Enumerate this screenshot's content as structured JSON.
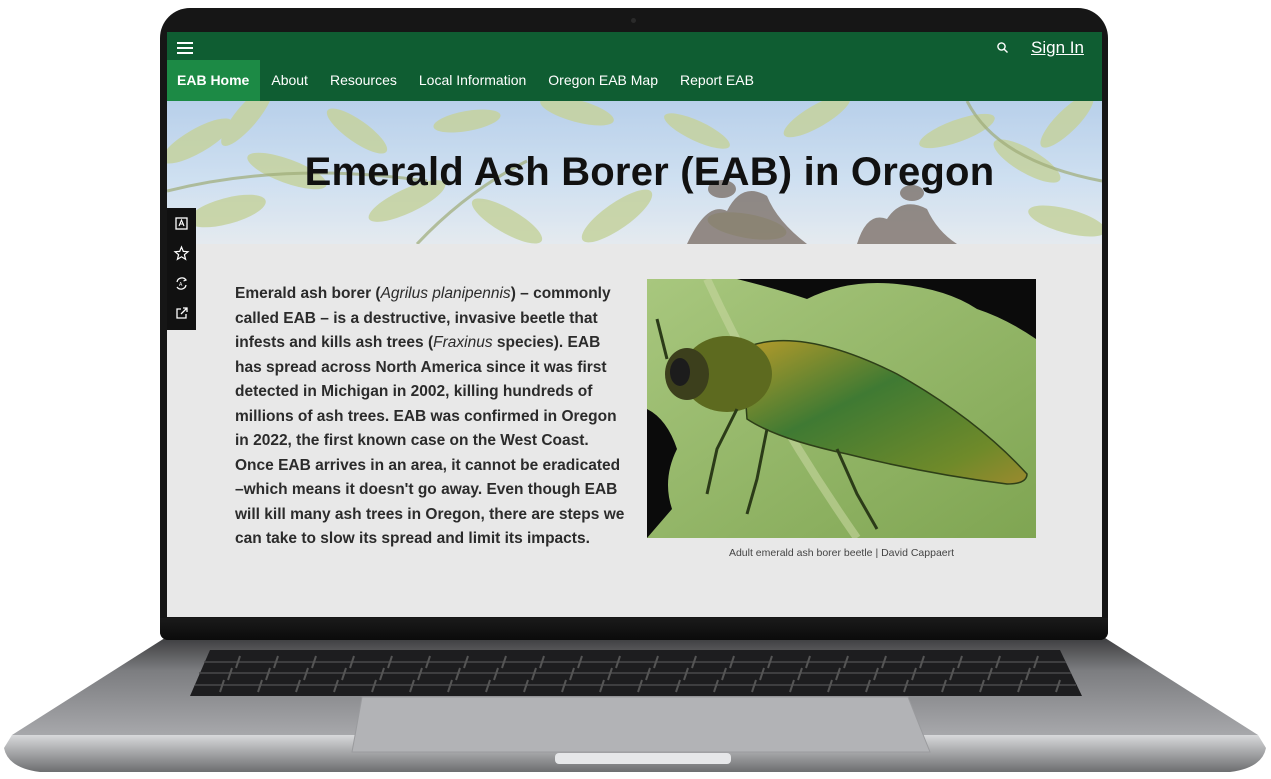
{
  "header": {
    "menu_icon": "hamburger-menu-icon",
    "search_icon": "search-icon",
    "signin_label": "Sign In",
    "brand_color": "#0f5d32",
    "active_color": "#1c8a45"
  },
  "nav": {
    "items": [
      {
        "label": "EAB Home",
        "active": true
      },
      {
        "label": "About"
      },
      {
        "label": "Resources"
      },
      {
        "label": "Local Information"
      },
      {
        "label": "Oregon EAB Map"
      },
      {
        "label": "Report EAB"
      }
    ]
  },
  "banner": {
    "title": "Emerald Ash Borer (EAB) in Oregon"
  },
  "sidebar": {
    "buttons": [
      {
        "icon": "translate-icon"
      },
      {
        "icon": "star-icon"
      },
      {
        "icon": "accessibility-icon"
      },
      {
        "icon": "share-icon"
      }
    ]
  },
  "content": {
    "p1": "Emerald ash borer (",
    "p1_italic": "Agrilus planipennis",
    "p2": ") – commonly called EAB – is a destructive, invasive beetle that infests and kills ash trees (",
    "p2_italic": "Fraxinus",
    "p3": " species). EAB has spread across North America since it was first detected in Michigan in 2002, killing hundreds of millions of ash trees. EAB was confirmed in Oregon in 2022, the first known case on the West Coast. Once EAB arrives in an area, it cannot be eradicated –which means it doesn't go away. Even though EAB will kill many ash trees in Oregon, there are steps we can take to slow its spread and limit its impacts."
  },
  "photo": {
    "caption": "Adult emerald ash borer beetle | David Cappaert"
  }
}
